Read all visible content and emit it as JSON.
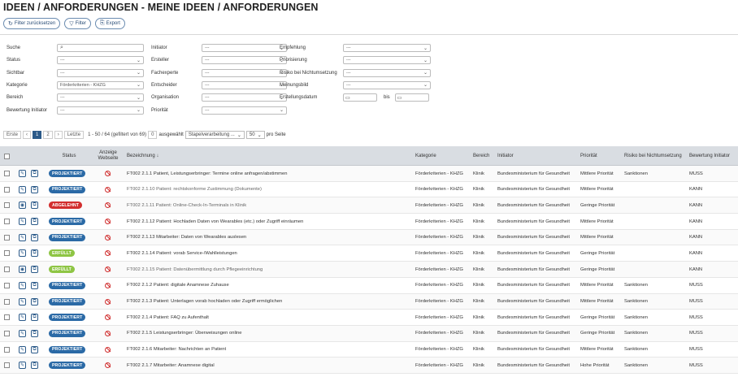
{
  "page": {
    "title": "IDEEN / ANFORDERUNGEN - MEINE IDEEN / ANFORDERUNGEN"
  },
  "toolbar": {
    "reset_label": "Filter zurücksetzen",
    "filter_label": "Filter",
    "export_label": "Export"
  },
  "filters": {
    "col1": [
      {
        "label": "Suche",
        "value": ""
      },
      {
        "label": "Status",
        "value": "---"
      },
      {
        "label": "Sichtbar",
        "value": "---"
      },
      {
        "label": "Kategorie",
        "value": "Förderkriterien - KHZG"
      },
      {
        "label": "Bereich",
        "value": "---"
      },
      {
        "label": "Bewertung Initiator",
        "value": "---"
      }
    ],
    "col2": [
      {
        "label": "Initiator",
        "value": "---"
      },
      {
        "label": "Ersteller",
        "value": "---"
      },
      {
        "label": "Fachexperte",
        "value": "---"
      },
      {
        "label": "Entscheider",
        "value": "---"
      },
      {
        "label": "Organisation",
        "value": "---"
      },
      {
        "label": "Priorität",
        "value": "---"
      }
    ],
    "col3": [
      {
        "label": "Empfehlung",
        "value": "---"
      },
      {
        "label": "Priorisierung",
        "value": "---"
      },
      {
        "label": "Risiko bei Nichtumsetzung",
        "value": "---"
      },
      {
        "label": "Meinungsbild",
        "value": "---"
      }
    ],
    "date": {
      "label": "Erstellungsdatum",
      "bis_label": "bis"
    }
  },
  "pager": {
    "first": "Erste",
    "prev": "‹",
    "pages": [
      "1",
      "2"
    ],
    "next": "›",
    "last": "Letzte",
    "info": "1 - 50 / 64 (gefiltert von 69)",
    "selected_count": "0",
    "selected_label": "ausgewählt",
    "bulk_action": "Stapelverarbeitung ...",
    "page_size": "50",
    "page_size_label": "pro Seite"
  },
  "table": {
    "headers": {
      "status": "Status",
      "website": "Anzeige Webseite",
      "name": "Bezeichnung ↓",
      "category": "Kategorie",
      "area": "Bereich",
      "initiator": "Initiator",
      "priority": "Priorität",
      "risk": "Risiko bei Nichtumsetzung",
      "rating": "Bewertung Initiator"
    },
    "rows": [
      {
        "status": "PROJEKTIERT",
        "color": "blue",
        "action_icon": "edit-icon",
        "name": "FT002 2.1.1 Patient, Leistungserbringer: Termine online anfragen/abstimmen",
        "category": "Förderkriterien - KHZG",
        "area": "Klinik",
        "initiator": "Bundesministerium für Gesundheit",
        "priority": "Mittlere Priorität",
        "risk": "Sanktionen",
        "rating": "MUSS"
      },
      {
        "status": "PROJEKTIERT",
        "color": "blue",
        "action_icon": "edit-icon",
        "name": "FT002 2.1.10 Patient: rechtskonforme Zustimmung (Dokumente)",
        "category": "Förderkriterien - KHZG",
        "area": "Klinik",
        "initiator": "Bundesministerium für Gesundheit",
        "priority": "Mittlere Priorität",
        "risk": "",
        "rating": "KANN"
      },
      {
        "status": "ABGELEHNT",
        "color": "red",
        "action_icon": "view-icon",
        "name": "FT002 2.1.11 Patient: Online-Check-In-Terminals in Klinik",
        "category": "Förderkriterien - KHZG",
        "area": "Klinik",
        "initiator": "Bundesministerium für Gesundheit",
        "priority": "Geringe Priorität",
        "risk": "",
        "rating": "KANN"
      },
      {
        "status": "PROJEKTIERT",
        "color": "blue",
        "action_icon": "edit-icon",
        "name": "FT002 2.1.12 Patient: Hochladen Daten von Wearables (etc.) oder Zugriff einräumen",
        "category": "Förderkriterien - KHZG",
        "area": "Klinik",
        "initiator": "Bundesministerium für Gesundheit",
        "priority": "Mittlere Priorität",
        "risk": "",
        "rating": "KANN"
      },
      {
        "status": "PROJEKTIERT",
        "color": "blue",
        "action_icon": "edit-icon",
        "name": "FT002 2.1.13 Mitarbeiter: Daten von Wearables auslesen",
        "category": "Förderkriterien - KHZG",
        "area": "Klinik",
        "initiator": "Bundesministerium für Gesundheit",
        "priority": "Mittlere Priorität",
        "risk": "",
        "rating": "KANN"
      },
      {
        "status": "ERFÜLLT",
        "color": "green",
        "action_icon": "edit-icon",
        "name": "FT002 2.1.14 Patient: vorab Service-/Wahlleistungen",
        "category": "Förderkriterien - KHZG",
        "area": "Klinik",
        "initiator": "Bundesministerium für Gesundheit",
        "priority": "Geringe Priorität",
        "risk": "",
        "rating": "KANN"
      },
      {
        "status": "ERFÜLLT",
        "color": "green",
        "action_icon": "view-icon",
        "name": "FT002 2.1.15 Patient: Datenübermittlung durch Pflegeeinrichtung",
        "category": "Förderkriterien - KHZG",
        "area": "Klinik",
        "initiator": "Bundesministerium für Gesundheit",
        "priority": "Geringe Priorität",
        "risk": "",
        "rating": "KANN"
      },
      {
        "status": "PROJEKTIERT",
        "color": "blue",
        "action_icon": "edit-icon",
        "name": "FT002 2.1.2 Patient: digitale Anamnese Zuhause",
        "category": "Förderkriterien - KHZG",
        "area": "Klinik",
        "initiator": "Bundesministerium für Gesundheit",
        "priority": "Mittlere Priorität",
        "risk": "Sanktionen",
        "rating": "MUSS"
      },
      {
        "status": "PROJEKTIERT",
        "color": "blue",
        "action_icon": "edit-icon",
        "name": "FT002 2.1.3 Patient: Unterlagen vorab hochladen oder Zugriff ermöglichen",
        "category": "Förderkriterien - KHZG",
        "area": "Klinik",
        "initiator": "Bundesministerium für Gesundheit",
        "priority": "Mittlere Priorität",
        "risk": "Sanktionen",
        "rating": "MUSS"
      },
      {
        "status": "PROJEKTIERT",
        "color": "blue",
        "action_icon": "edit-icon",
        "name": "FT002 2.1.4 Patient: FAQ zu Aufenthalt",
        "category": "Förderkriterien - KHZG",
        "area": "Klinik",
        "initiator": "Bundesministerium für Gesundheit",
        "priority": "Geringe Priorität",
        "risk": "Sanktionen",
        "rating": "MUSS"
      },
      {
        "status": "PROJEKTIERT",
        "color": "blue",
        "action_icon": "edit-icon",
        "name": "FT002 2.1.5 Leistungserbringer: Überweisungen online",
        "category": "Förderkriterien - KHZG",
        "area": "Klinik",
        "initiator": "Bundesministerium für Gesundheit",
        "priority": "Geringe Priorität",
        "risk": "Sanktionen",
        "rating": "MUSS"
      },
      {
        "status": "PROJEKTIERT",
        "color": "blue",
        "action_icon": "edit-icon",
        "name": "FT002 2.1.6 Mitarbeiter: Nachrichten an Patient",
        "category": "Förderkriterien - KHZG",
        "area": "Klinik",
        "initiator": "Bundesministerium für Gesundheit",
        "priority": "Mittlere Priorität",
        "risk": "Sanktionen",
        "rating": "MUSS"
      },
      {
        "status": "PROJEKTIERT",
        "color": "blue",
        "action_icon": "edit-icon",
        "name": "FT002 2.1.7 Mitarbeiter: Anamnese digital",
        "category": "Förderkriterien - KHZG",
        "area": "Klinik",
        "initiator": "Bundesministerium für Gesundheit",
        "priority": "Hohe Priorität",
        "risk": "Sanktionen",
        "rating": "MUSS"
      }
    ]
  },
  "colors": {
    "accent": "#2b5a89",
    "blue": "#2b6aa6",
    "red": "#d22e2e",
    "green": "#8ec544",
    "header_bg": "#d9dde2"
  }
}
